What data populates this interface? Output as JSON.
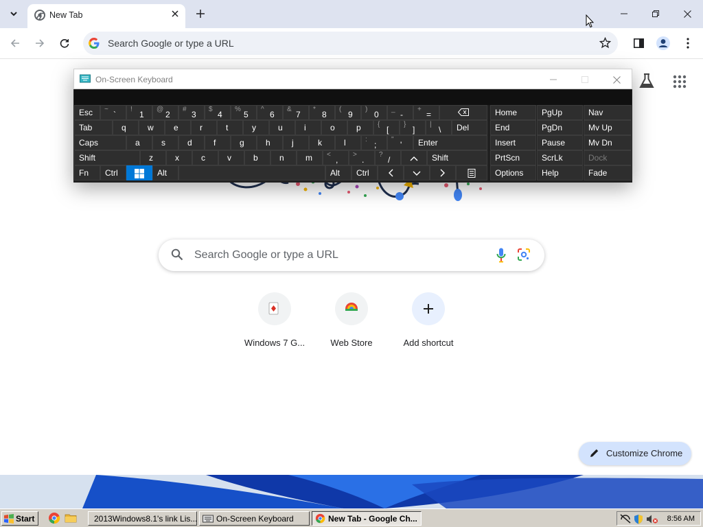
{
  "browser": {
    "tab_title": "New Tab",
    "omnibox_placeholder": "Search Google or type a URL"
  },
  "ntp": {
    "search_placeholder": "Search Google or type a URL",
    "shortcuts": [
      {
        "label": "Windows 7 G...",
        "icon": "solitaire-icon"
      },
      {
        "label": "Web Store",
        "icon": "chrome-web-store-icon"
      },
      {
        "label": "Add shortcut",
        "icon": "plus-icon"
      }
    ],
    "customize_label": "Customize Chrome"
  },
  "osk": {
    "title": "On-Screen Keyboard",
    "row1": [
      {
        "label": "Esc"
      },
      {
        "shift": "~",
        "main": "`"
      },
      {
        "shift": "!",
        "main": "1"
      },
      {
        "shift": "@",
        "main": "2"
      },
      {
        "shift": "#",
        "main": "3"
      },
      {
        "shift": "$",
        "main": "4"
      },
      {
        "shift": "%",
        "main": "5"
      },
      {
        "shift": "^",
        "main": "6"
      },
      {
        "shift": "&",
        "main": "7"
      },
      {
        "shift": "*",
        "main": "8"
      },
      {
        "shift": "(",
        "main": "9"
      },
      {
        "shift": ")",
        "main": "0"
      },
      {
        "shift": "_",
        "main": "-"
      },
      {
        "shift": "+",
        "main": "="
      },
      {
        "icon": "backspace-icon"
      }
    ],
    "row2": [
      {
        "label": "Tab"
      },
      {
        "main": "q"
      },
      {
        "main": "w"
      },
      {
        "main": "e"
      },
      {
        "main": "r"
      },
      {
        "main": "t"
      },
      {
        "main": "y"
      },
      {
        "main": "u"
      },
      {
        "main": "i"
      },
      {
        "main": "o"
      },
      {
        "main": "p"
      },
      {
        "shift": "{",
        "main": "["
      },
      {
        "shift": "}",
        "main": "]"
      },
      {
        "shift": "|",
        "main": "\\"
      },
      {
        "label": "Del"
      }
    ],
    "row3": [
      {
        "label": "Caps"
      },
      {
        "main": "a"
      },
      {
        "main": "s"
      },
      {
        "main": "d"
      },
      {
        "main": "f"
      },
      {
        "main": "g"
      },
      {
        "main": "h"
      },
      {
        "main": "j"
      },
      {
        "main": "k"
      },
      {
        "main": "l"
      },
      {
        "shift": ":",
        "main": ";"
      },
      {
        "shift": "\"",
        "main": "'"
      },
      {
        "label": "Enter"
      }
    ],
    "row4": [
      {
        "label": "Shift"
      },
      {
        "main": "z"
      },
      {
        "main": "x"
      },
      {
        "main": "c"
      },
      {
        "main": "v"
      },
      {
        "main": "b"
      },
      {
        "main": "n"
      },
      {
        "main": "m"
      },
      {
        "shift": "<",
        "main": ","
      },
      {
        "shift": ">",
        "main": "."
      },
      {
        "shift": "?",
        "main": "/"
      },
      {
        "icon": "arrow-up-icon"
      },
      {
        "label": "Shift"
      }
    ],
    "row5": [
      {
        "label": "Fn"
      },
      {
        "label": "Ctrl"
      },
      {
        "icon": "windows-logo-icon"
      },
      {
        "label": "Alt"
      },
      {
        "label": ""
      },
      {
        "label": "Alt"
      },
      {
        "label": "Ctrl"
      },
      {
        "icon": "arrow-left-icon"
      },
      {
        "icon": "arrow-down-icon"
      },
      {
        "icon": "arrow-right-icon"
      },
      {
        "icon": "menu-key-icon"
      }
    ],
    "nav_keys": [
      [
        "Home",
        "PgUp",
        "Nav"
      ],
      [
        "End",
        "PgDn",
        "Mv Up"
      ],
      [
        "Insert",
        "Pause",
        "Mv Dn"
      ],
      [
        "PrtScn",
        "ScrLk",
        "Dock"
      ],
      [
        "Options",
        "Help",
        "Fade"
      ]
    ]
  },
  "taskbar": {
    "start_label": "Start",
    "tasks": [
      {
        "label": "2013Windows8.1's link Lis...",
        "icon": "notepad-icon"
      },
      {
        "label": "On-Screen Keyboard",
        "icon": "keyboard-icon"
      },
      {
        "label": "New Tab - Google Ch...",
        "icon": "chrome-icon"
      }
    ],
    "clock": "8:56 AM"
  }
}
